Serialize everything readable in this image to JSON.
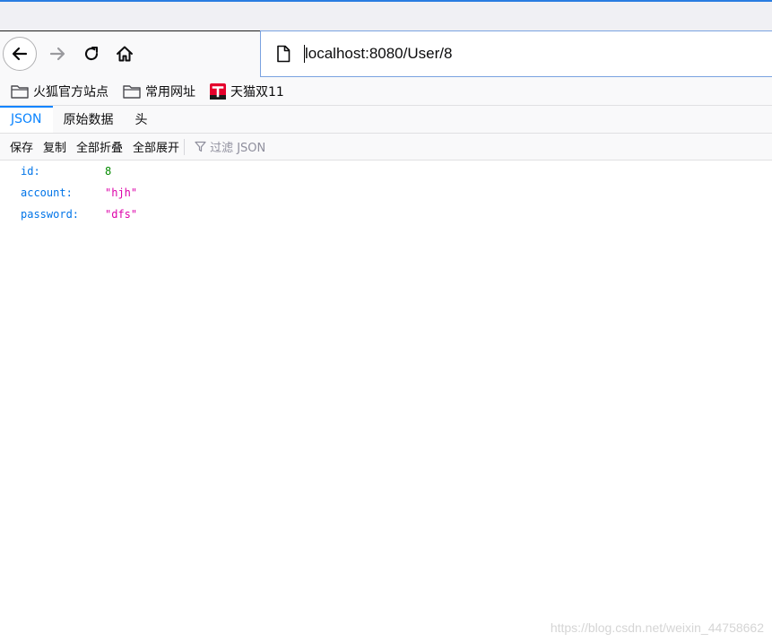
{
  "browser": {
    "url": "localhost:8080/User/8",
    "icons": {
      "back": "back-arrow-icon",
      "forward": "forward-arrow-icon",
      "reload": "reload-icon",
      "home": "home-icon",
      "page": "page-icon"
    }
  },
  "bookmarks": [
    {
      "label": "火狐官方站点",
      "icon": "folder-icon"
    },
    {
      "label": "常用网址",
      "icon": "folder-icon"
    },
    {
      "label": "天猫双11",
      "icon": "tmall-icon"
    }
  ],
  "viewer": {
    "tabs": [
      {
        "label": "JSON",
        "selected": true
      },
      {
        "label": "原始数据",
        "selected": false
      },
      {
        "label": "头",
        "selected": false
      }
    ],
    "toolbar": {
      "save": "保存",
      "copy": "复制",
      "collapse_all": "全部折叠",
      "expand_all": "全部展开",
      "filter_placeholder": "过滤 JSON"
    },
    "json_rows": [
      {
        "key": "id:",
        "value": "8",
        "type": "number"
      },
      {
        "key": "account:",
        "value": "\"hjh\"",
        "type": "string"
      },
      {
        "key": "password:",
        "value": "\"dfs\"",
        "type": "string"
      }
    ]
  },
  "watermark": "https://blog.csdn.net/weixin_44758662",
  "colors": {
    "accent": "#0a84ff",
    "json_key": "#0074e8",
    "json_number": "#058b00",
    "json_string": "#dd00a9"
  }
}
